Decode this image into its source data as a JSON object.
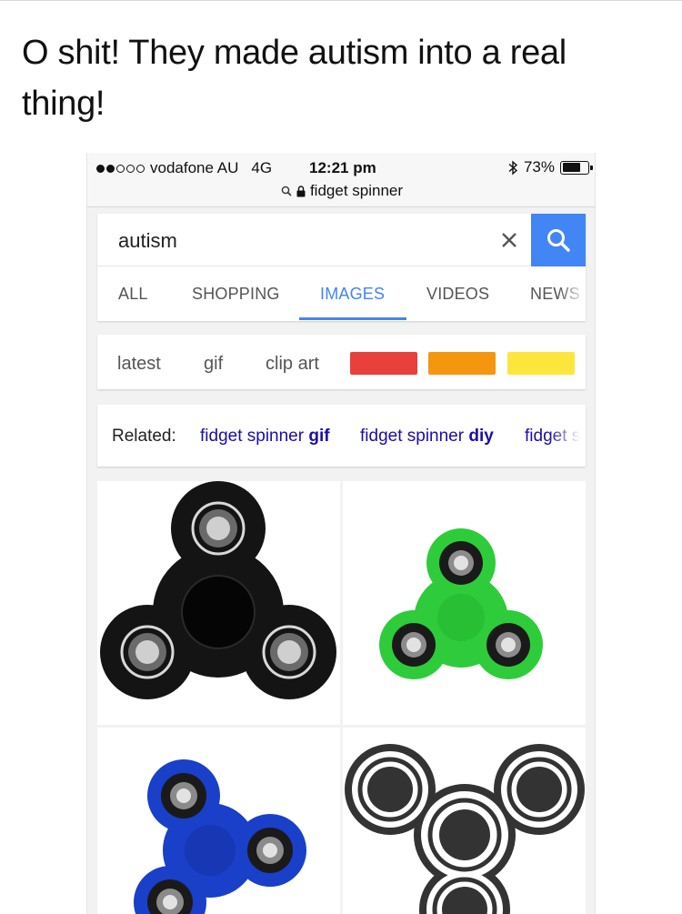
{
  "post": {
    "caption": "O shit! They made autism into a real thing!"
  },
  "statusbar": {
    "carrier": "vodafone AU",
    "network": "4G",
    "time": "12:21 pm",
    "battery": "73%",
    "battery_level": 0.73,
    "signal_bars_filled": 2,
    "signal_bars_total": 5,
    "url": "fidget spinner"
  },
  "search": {
    "query": "autism"
  },
  "tabs": [
    {
      "label": "ALL",
      "active": false
    },
    {
      "label": "SHOPPING",
      "active": false
    },
    {
      "label": "IMAGES",
      "active": true
    },
    {
      "label": "VIDEOS",
      "active": false
    },
    {
      "label": "NEWS",
      "active": false
    }
  ],
  "filters": {
    "chips": [
      "latest",
      "gif",
      "clip art"
    ],
    "colors": [
      "#e8403a",
      "#f5960f",
      "#fde63c"
    ]
  },
  "related": {
    "label": "Related:",
    "links": [
      {
        "prefix": "fidget spinner ",
        "bold": "gif"
      },
      {
        "prefix": "fidget spinner ",
        "bold": "diy"
      },
      {
        "prefix": "fidget s",
        "bold": ""
      }
    ]
  },
  "results": [
    {
      "name": "black-fidget-spinner",
      "color": "#141414"
    },
    {
      "name": "green-fidget-spinner",
      "color": "#2ecc3a"
    },
    {
      "name": "blue-fidget-spinner",
      "color": "#1a3fc8"
    },
    {
      "name": "outline-fidget-spinner-icon",
      "color": "#333333"
    }
  ],
  "accent": "#4285f4",
  "link_color": "#1a0dab"
}
